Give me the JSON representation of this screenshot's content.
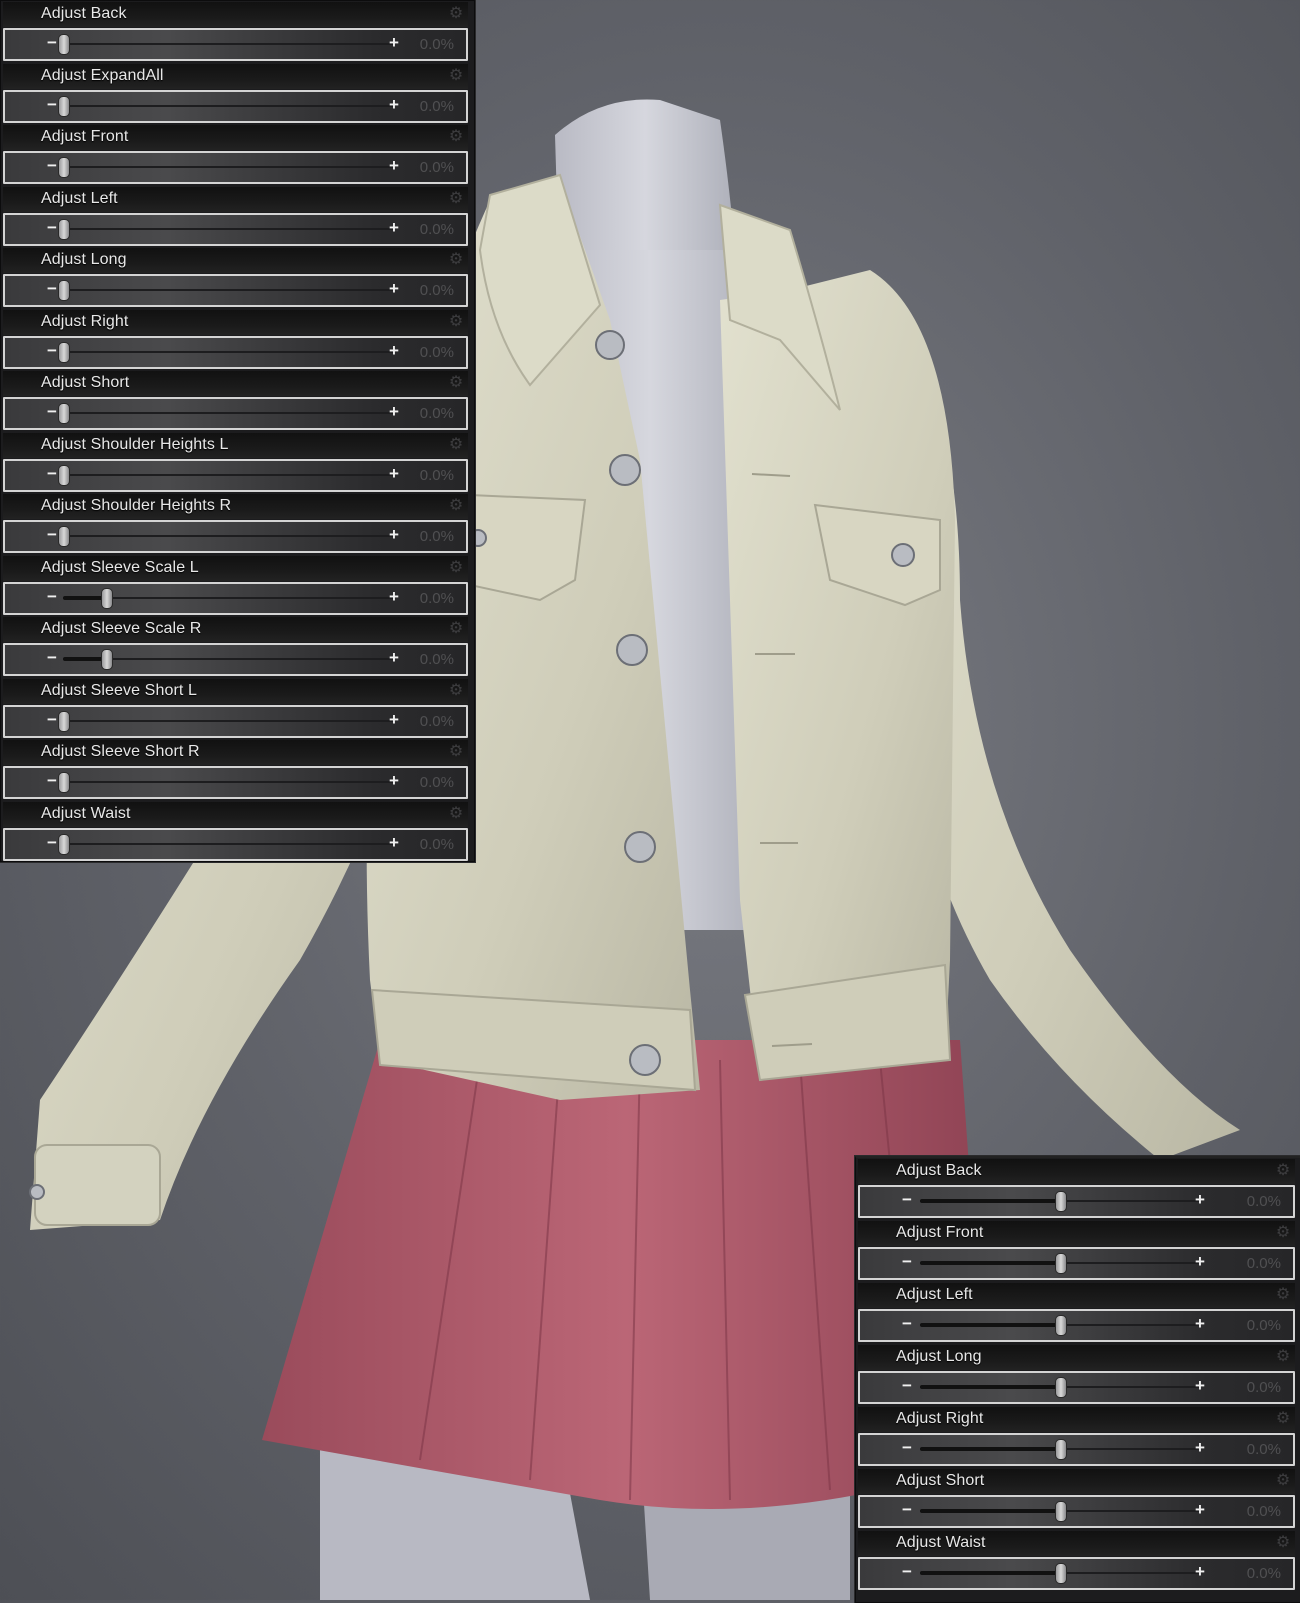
{
  "colors": {
    "background": "#5f6168",
    "jacket": "#d9d8c6",
    "skirt": "#b45e6f",
    "mannequin": "#c9cad2",
    "panel_bg": "#1c1c1e",
    "label_text": "#e8e8e8",
    "value_text": "#505052"
  },
  "left_panel": {
    "sliders": [
      {
        "label": "Adjust Back",
        "value": "0.0%",
        "position": 0.0
      },
      {
        "label": "Adjust ExpandAll",
        "value": "0.0%",
        "position": 0.0
      },
      {
        "label": "Adjust Front",
        "value": "0.0%",
        "position": 0.0
      },
      {
        "label": "Adjust Left",
        "value": "0.0%",
        "position": 0.0
      },
      {
        "label": "Adjust Long",
        "value": "0.0%",
        "position": 0.0
      },
      {
        "label": "Adjust Right",
        "value": "0.0%",
        "position": 0.0
      },
      {
        "label": "Adjust Short",
        "value": "0.0%",
        "position": 0.0
      },
      {
        "label": "Adjust Shoulder Heights L",
        "value": "0.0%",
        "position": 0.0
      },
      {
        "label": "Adjust Shoulder Heights R",
        "value": "0.0%",
        "position": 0.0
      },
      {
        "label": "Adjust Sleeve Scale L",
        "value": "0.0%",
        "position": 0.13
      },
      {
        "label": "Adjust Sleeve Scale R",
        "value": "0.0%",
        "position": 0.13
      },
      {
        "label": "Adjust Sleeve Short L",
        "value": "0.0%",
        "position": 0.0
      },
      {
        "label": "Adjust Sleeve Short R",
        "value": "0.0%",
        "position": 0.0
      },
      {
        "label": "Adjust Waist",
        "value": "0.0%",
        "position": 0.0
      }
    ]
  },
  "right_panel": {
    "sliders": [
      {
        "label": "Adjust Back",
        "value": "0.0%",
        "position": 0.5
      },
      {
        "label": "Adjust Front",
        "value": "0.0%",
        "position": 0.5
      },
      {
        "label": "Adjust Left",
        "value": "0.0%",
        "position": 0.5
      },
      {
        "label": "Adjust Long",
        "value": "0.0%",
        "position": 0.5
      },
      {
        "label": "Adjust Right",
        "value": "0.0%",
        "position": 0.5
      },
      {
        "label": "Adjust Short",
        "value": "0.0%",
        "position": 0.5
      },
      {
        "label": "Adjust Waist",
        "value": "0.0%",
        "position": 0.5
      }
    ]
  },
  "icons": {
    "minus": "−",
    "plus": "+",
    "gear": "⚙"
  }
}
